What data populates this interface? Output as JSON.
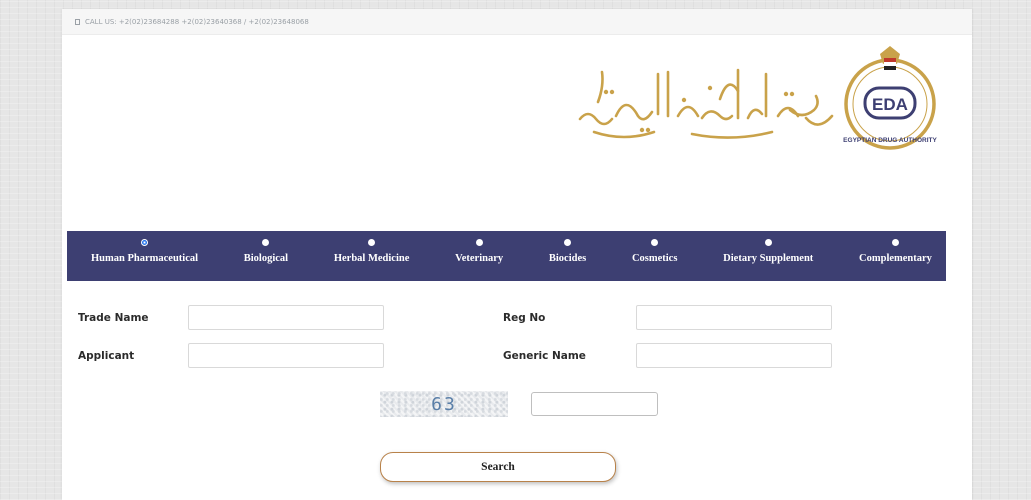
{
  "topbar": {
    "call_text": "CALL US: +2(02)23684288 +2(02)23640368 / +2(02)23648068"
  },
  "logo": {
    "org_name_en": "EGYPTIAN DRUG AUTHORITY",
    "abbreviation": "EDA",
    "brand_color": "#3d3f72"
  },
  "nav": {
    "items": [
      {
        "label": "Human Pharmaceutical",
        "selected": true
      },
      {
        "label": "Biological",
        "selected": false
      },
      {
        "label": "Herbal Medicine",
        "selected": false
      },
      {
        "label": "Veterinary",
        "selected": false
      },
      {
        "label": "Biocides",
        "selected": false
      },
      {
        "label": "Cosmetics",
        "selected": false
      },
      {
        "label": "Dietary Supplement",
        "selected": false
      },
      {
        "label": "Complementary",
        "selected": false
      }
    ]
  },
  "form": {
    "trade_name_label": "Trade Name",
    "trade_name_value": "",
    "reg_no_label": "Reg No",
    "reg_no_value": "",
    "applicant_label": "Applicant",
    "applicant_value": "",
    "generic_name_label": "Generic Name",
    "generic_name_value": "",
    "captcha_text": "63",
    "captcha_value": "",
    "search_label": "Search"
  },
  "colors": {
    "navbar_bg": "#3d3f72",
    "button_border": "#b8824a",
    "gold": "#c9a24a"
  }
}
